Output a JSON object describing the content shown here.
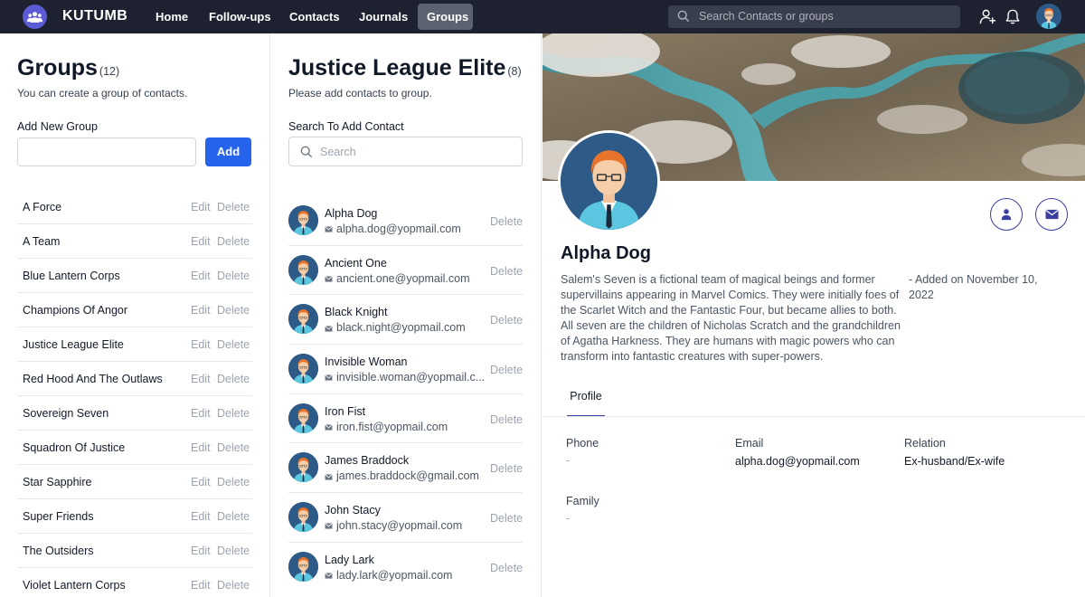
{
  "nav": {
    "brand": "KUTUMB",
    "items": [
      {
        "label": "Home"
      },
      {
        "label": "Follow-ups"
      },
      {
        "label": "Contacts"
      },
      {
        "label": "Journals"
      },
      {
        "label": "Groups"
      }
    ],
    "active": "Groups",
    "search_placeholder": "Search Contacts or groups",
    "icons": [
      "add-user-icon",
      "bell-icon",
      "avatar"
    ]
  },
  "groups_panel": {
    "title": "Groups",
    "count": "(12)",
    "subtitle": "You can create a group of contacts.",
    "add_label": "Add New Group",
    "add_input_value": "",
    "add_button": "Add",
    "edit_label": "Edit",
    "delete_label": "Delete",
    "groups": [
      "A Force",
      "A Team",
      "Blue Lantern Corps",
      "Champions Of Angor",
      "Justice League Elite",
      "Red Hood And The Outlaws",
      "Sovereign Seven",
      "Squadron Of Justice",
      "Star Sapphire",
      "Super Friends",
      "The Outsiders",
      "Violet Lantern Corps"
    ]
  },
  "group_detail": {
    "title": "Justice League Elite",
    "count": "(8)",
    "subtitle": "Please add contacts to group.",
    "search_label": "Search To Add Contact",
    "search_placeholder": "Search",
    "delete_label": "Delete",
    "contacts": [
      {
        "name": "Alpha Dog",
        "email": "alpha.dog@yopmail.com"
      },
      {
        "name": "Ancient One",
        "email": "ancient.one@yopmail.com"
      },
      {
        "name": "Black Knight",
        "email": "black.night@yopmail.com"
      },
      {
        "name": "Invisible Woman",
        "email": "invisible.woman@yopmail.c..."
      },
      {
        "name": "Iron Fist",
        "email": "iron.fist@yopmail.com"
      },
      {
        "name": "James Braddock",
        "email": "james.braddock@gmail.com"
      },
      {
        "name": "John Stacy",
        "email": "john.stacy@yopmail.com"
      },
      {
        "name": "Lady Lark",
        "email": "lady.lark@yopmail.com"
      }
    ]
  },
  "profile": {
    "name": "Alpha Dog",
    "bio": "Salem's Seven is a fictional team of magical beings and former supervillains appearing in Marvel Comics. They were initially foes of the Scarlet Witch and the Fantastic Four, but became allies to both. All seven are the children of Nicholas Scratch and the grandchildren of Agatha Harkness. They are humans with magic powers who can transform into fantastic creatures with super-powers.",
    "added": "- Added on November 10, 2022",
    "tab": "Profile",
    "fields": {
      "phone_label": "Phone",
      "phone_value": "-",
      "email_label": "Email",
      "email_value": "alpha.dog@yopmail.com",
      "relation_label": "Relation",
      "relation_value": "Ex-husband/Ex-wife",
      "family_label": "Family",
      "family_value": "-"
    },
    "action_icons": [
      "person-icon",
      "mail-icon"
    ]
  },
  "colors": {
    "nav_bg": "#1e2230",
    "accent": "#2563eb",
    "indigo": "#3b3fa0"
  }
}
